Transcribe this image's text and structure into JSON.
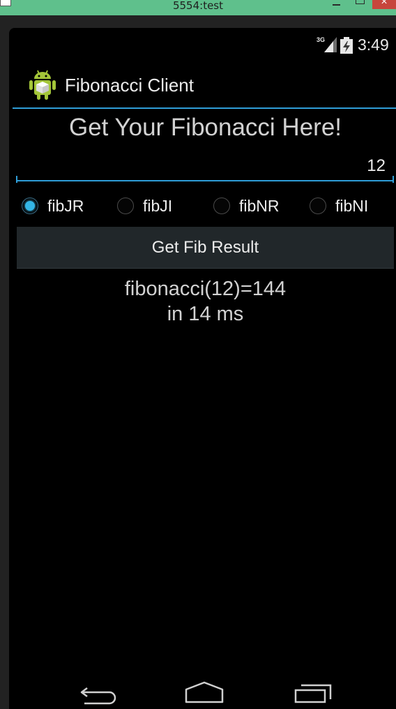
{
  "window": {
    "title": "5554:test"
  },
  "status_bar": {
    "network": "3G",
    "time": "3:49"
  },
  "action_bar": {
    "title": "Fibonacci Client",
    "icon": "android-robot-icon"
  },
  "main": {
    "heading": "Get Your Fibonacci Here!",
    "input_value": "12",
    "radio_options": [
      {
        "label": "fibJR",
        "checked": true
      },
      {
        "label": "fibJI",
        "checked": false
      },
      {
        "label": "fibNR",
        "checked": false
      },
      {
        "label": "fibNI",
        "checked": false
      }
    ],
    "button_label": "Get Fib Result",
    "result_line1": "fibonacci(12)=144",
    "result_line2": "in 14 ms"
  },
  "nav_bar": {
    "icons": [
      "back-icon",
      "home-icon",
      "recent-apps-icon"
    ]
  },
  "colors": {
    "accent": "#33b5e5",
    "window_titlebar": "#5fc08c",
    "close_button": "#c7453c",
    "background": "#000000"
  }
}
